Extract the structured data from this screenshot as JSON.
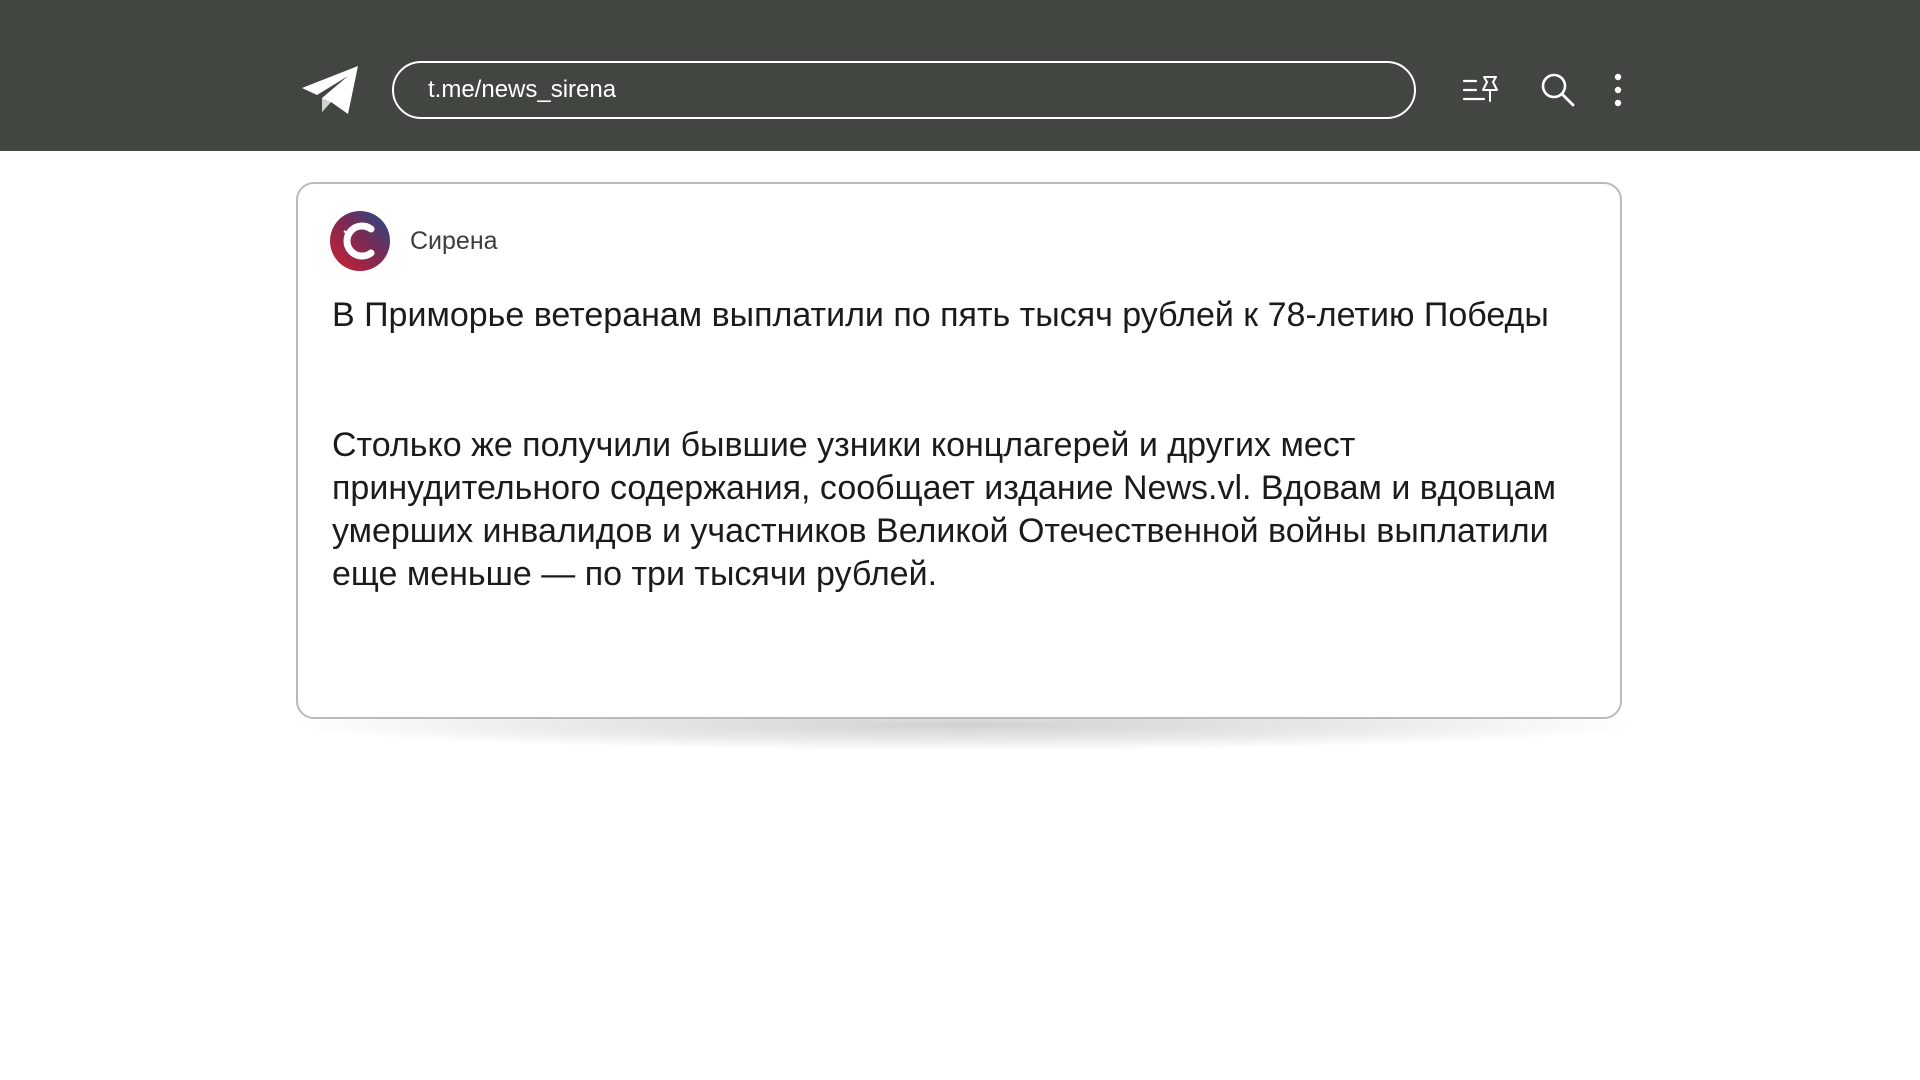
{
  "header": {
    "url": "t.me/news_sirena",
    "icons": [
      "telegram-logo-icon",
      "pinned-list-icon",
      "search-icon",
      "more-vertical-icon"
    ]
  },
  "post": {
    "channel_name": "Сирена",
    "avatar_icon": "sirena-logo-icon",
    "title": "В Приморье ветеранам выплатили по пять тысяч рублей к 78-летию Победы",
    "body": "Столько же получили бывшие узники концлагерей и других мест принудительного содержания, сообщает издание News.vl. Вдовам и вдовцам умерших инвалидов и участников Великой Отечественной войны выплатили еще меньше — по три тысячи рублей."
  },
  "colors": {
    "topbar": "#424641",
    "card_border": "#b9bbbb",
    "text": "#1b1b1b",
    "avatar_red": "#d0202e",
    "avatar_blue": "#1e4f8a"
  }
}
